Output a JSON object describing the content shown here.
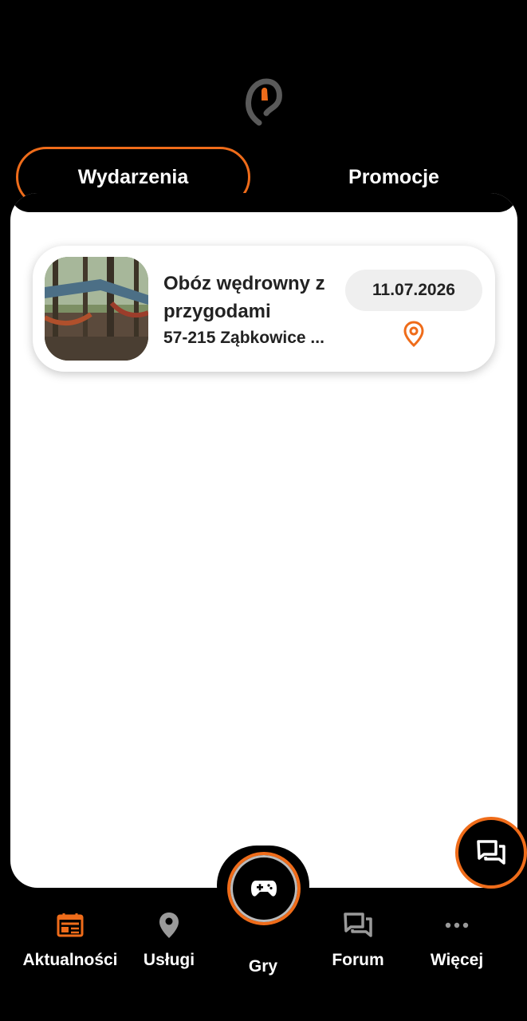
{
  "tabs": {
    "active_label": "Wydarzenia",
    "inactive_label": "Promocje"
  },
  "events": [
    {
      "title": "Obóz wędrowny z przygodami",
      "address": "57-215 Ząbkowice ...",
      "date": "11.07.2026"
    }
  ],
  "nav": {
    "items": [
      {
        "label": "Aktualności",
        "icon": "newspaper-icon"
      },
      {
        "label": "Usługi",
        "icon": "location-pin-icon"
      },
      {
        "label": "Gry",
        "icon": "gamepad-icon"
      },
      {
        "label": "Forum",
        "icon": "forum-icon"
      },
      {
        "label": "Więcej",
        "icon": "more-dots-icon"
      }
    ]
  },
  "colors": {
    "accent": "#ef6c1a",
    "background": "#000000",
    "surface": "#ffffff",
    "inactive_icon": "#9a9a9a"
  }
}
